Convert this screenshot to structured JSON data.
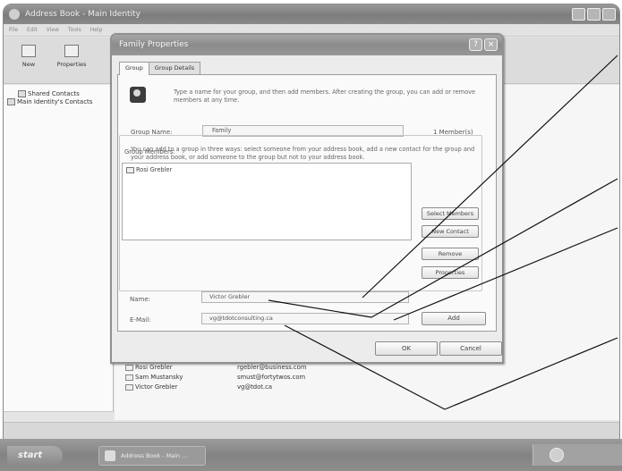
{
  "app": {
    "title": "Address Book - Main Identity",
    "menu": [
      "File",
      "Edit",
      "View",
      "Tools",
      "Help"
    ],
    "toolbar": {
      "new_label": "New",
      "properties_label": "Properties"
    },
    "tree": {
      "shared_contacts": "Shared Contacts",
      "main_identity": "Main Identity's Contacts"
    },
    "contacts": [
      {
        "name": "Rosi Grebler",
        "email": "rgebler@business.com"
      },
      {
        "name": "Sam Mustansky",
        "email": "smust@fortytwos.com"
      },
      {
        "name": "Victor Grebler",
        "email": "vg@tdot.ca"
      }
    ]
  },
  "taskbar": {
    "start_label": "start",
    "task_label": "Address Book - Main ..."
  },
  "dialog": {
    "title": "Family Properties",
    "tabs": [
      {
        "label": "Group"
      },
      {
        "label": "Group Details"
      }
    ],
    "intro": "Type a name for your group, and then add members. After creating the group, you can add or remove members at any time.",
    "group_name_label": "Group Name:",
    "group_name_value": "Family",
    "member_count": "1 Member(s)",
    "info": "You can add to a group in three ways: select someone from your address book, add a new contact for the group and your address book, or add someone to the group but not to your address book.",
    "members_label": "Group Members:",
    "members": [
      "Rosi Grebler"
    ],
    "buttons": {
      "select_members": "Select Members",
      "new_contact": "New Contact",
      "remove": "Remove",
      "properties": "Properties",
      "add": "Add",
      "ok": "OK",
      "cancel": "Cancel"
    },
    "name_label": "Name:",
    "name_value": "Victor Grebler",
    "email_label": "E-Mail:",
    "email_value": "vg@tdotconsulting.ca"
  }
}
